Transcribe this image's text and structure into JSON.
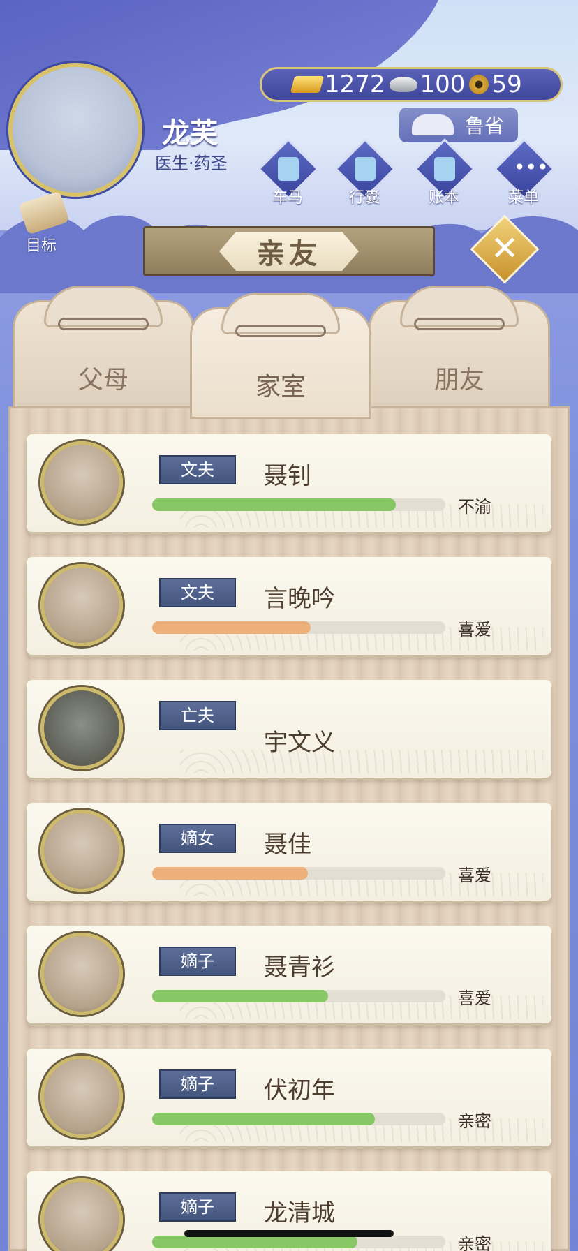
{
  "character": {
    "name": "龙芙",
    "title": "医生·药圣"
  },
  "currency": {
    "gold": "1272",
    "silver": "100",
    "coins": "59"
  },
  "region": {
    "label": "鲁省"
  },
  "menu": [
    {
      "label": "车马",
      "icon": "carriage-icon"
    },
    {
      "label": "行囊",
      "icon": "bag-icon"
    },
    {
      "label": "账本",
      "icon": "ledger-icon"
    },
    {
      "label": "菜单",
      "icon": "more-icon"
    }
  ],
  "goal": {
    "label": "目标"
  },
  "section": {
    "title": "亲友"
  },
  "tabs": [
    {
      "label": "父母"
    },
    {
      "label": "家室"
    },
    {
      "label": "朋友"
    }
  ],
  "colors": {
    "green": "#88c766",
    "orange": "#edb07a"
  },
  "members": [
    {
      "role": "文夫",
      "name": "聂钊",
      "status": "不渝",
      "level": 0.83,
      "color": "green"
    },
    {
      "role": "文夫",
      "name": "言晚吟",
      "status": "喜爱",
      "level": 0.54,
      "color": "orange"
    },
    {
      "role": "亡夫",
      "name": "宇文义",
      "status": "",
      "level": null,
      "color": ""
    },
    {
      "role": "嫡女",
      "name": "聂佳",
      "status": "喜爱",
      "level": 0.53,
      "color": "orange"
    },
    {
      "role": "嫡子",
      "name": "聂青衫",
      "status": "喜爱",
      "level": 0.6,
      "color": "green"
    },
    {
      "role": "嫡子",
      "name": "伏初年",
      "status": "亲密",
      "level": 0.76,
      "color": "green"
    },
    {
      "role": "嫡子",
      "name": "龙清城",
      "status": "亲密",
      "level": 0.7,
      "color": "green"
    }
  ]
}
